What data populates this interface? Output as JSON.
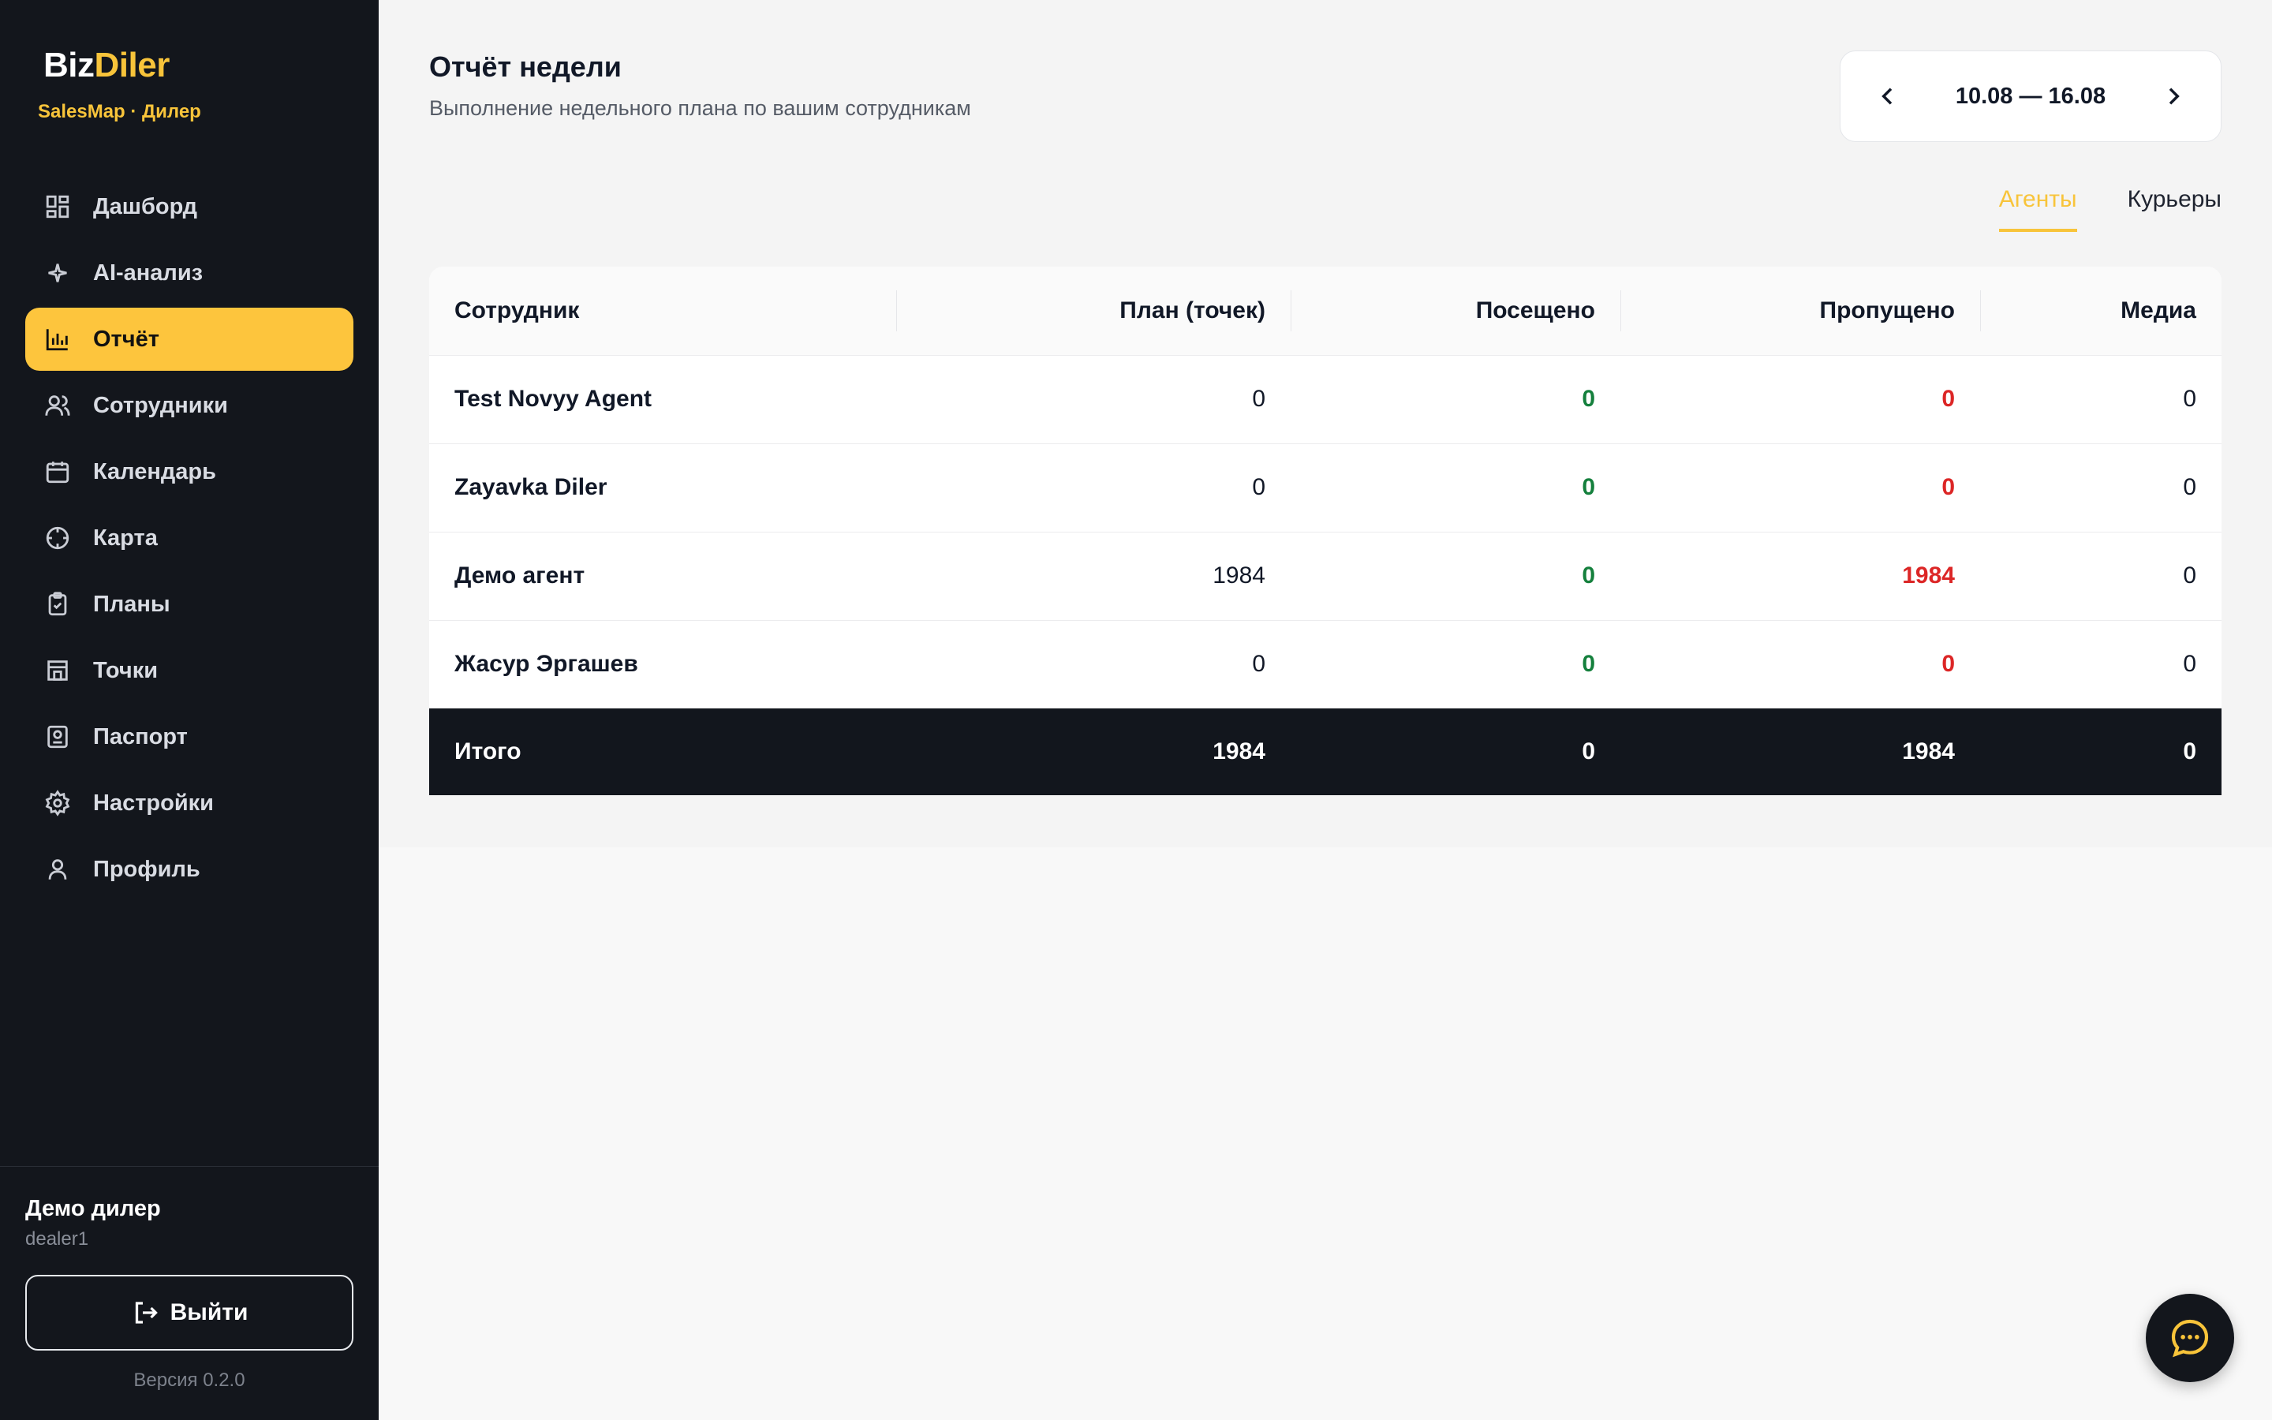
{
  "sidebar": {
    "brand_part1": "Biz",
    "brand_part2": "Diler",
    "brand_sub": "SalesMap · Дилер",
    "items": [
      {
        "label": "Дашборд",
        "icon": "dashboard-icon"
      },
      {
        "label": "AI-анализ",
        "icon": "sparkle-icon"
      },
      {
        "label": "Отчёт",
        "icon": "bar-chart-icon",
        "active": true
      },
      {
        "label": "Сотрудники",
        "icon": "users-icon"
      },
      {
        "label": "Календарь",
        "icon": "calendar-icon"
      },
      {
        "label": "Карта",
        "icon": "crosshair-icon"
      },
      {
        "label": "Планы",
        "icon": "clipboard-icon"
      },
      {
        "label": "Точки",
        "icon": "store-icon"
      },
      {
        "label": "Паспорт",
        "icon": "passport-icon"
      },
      {
        "label": "Настройки",
        "icon": "gear-icon"
      },
      {
        "label": "Профиль",
        "icon": "user-icon"
      }
    ],
    "user_name": "Демо дилер",
    "user_login": "dealer1",
    "logout_label": "Выйти",
    "version": "Версия 0.2.0"
  },
  "header": {
    "title": "Отчёт недели",
    "subtitle": "Выполнение недельного плана по вашим сотрудникам",
    "week_range": "10.08 — 16.08"
  },
  "tabs": [
    {
      "label": "Агенты",
      "active": true
    },
    {
      "label": "Курьеры",
      "active": false
    }
  ],
  "table": {
    "columns": [
      "Сотрудник",
      "План (точек)",
      "Посещено",
      "Пропущено",
      "Медиа"
    ],
    "rows": [
      {
        "name": "Test Novyy Agent",
        "plan": "0",
        "visited": "0",
        "missed": "0",
        "media": "0"
      },
      {
        "name": "Zayavka Diler",
        "plan": "0",
        "visited": "0",
        "missed": "0",
        "media": "0"
      },
      {
        "name": "Демо агент",
        "plan": "1984",
        "visited": "0",
        "missed": "1984",
        "media": "0"
      },
      {
        "name": "Жасур Эргашев",
        "plan": "0",
        "visited": "0",
        "missed": "0",
        "media": "0"
      }
    ],
    "total": {
      "label": "Итого",
      "plan": "1984",
      "visited": "0",
      "missed": "1984",
      "media": "0"
    }
  },
  "colors": {
    "accent": "#fdc53d",
    "sidebar_bg": "#13161c",
    "visited": "#15803d",
    "missed": "#dc2626"
  },
  "chat_icon": "chat-bubble-icon"
}
